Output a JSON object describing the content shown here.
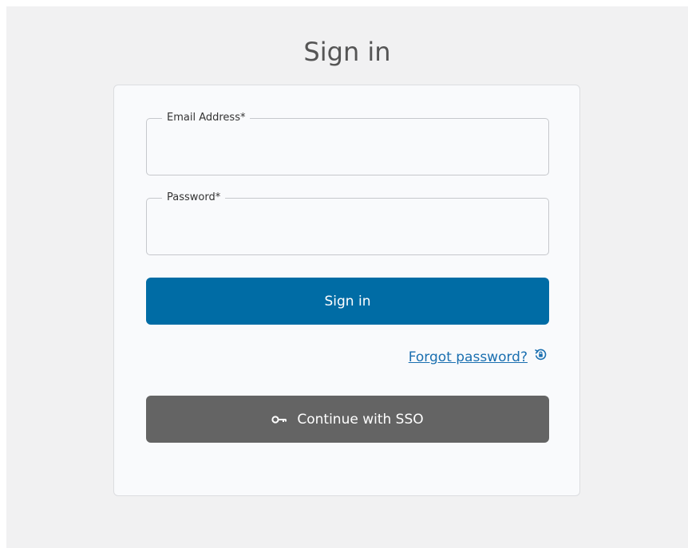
{
  "page": {
    "title": "Sign in"
  },
  "form": {
    "email": {
      "label": "Email Address*",
      "value": ""
    },
    "password": {
      "label": "Password*",
      "value": ""
    },
    "sign_in_button": "Sign in",
    "forgot_password_link": "Forgot password?",
    "sso_button": "Continue with SSO"
  },
  "icons": {
    "forgot": "reset-password-icon",
    "sso": "key-icon"
  },
  "colors": {
    "primary": "#006ca5",
    "secondary": "#646464",
    "link": "#1a6fb0",
    "background": "#f1f1f2",
    "card": "#f9fafc"
  }
}
